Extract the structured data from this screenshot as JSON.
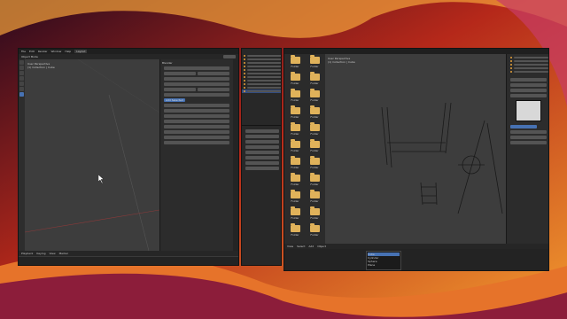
{
  "colors": {
    "accent": "#4772b3",
    "folder": "#e0b25a",
    "viewport": "#3d3d3d",
    "header": "#1f1f1f",
    "panel": "#2c2c2c"
  },
  "left_window": {
    "menus": [
      "File",
      "Edit",
      "Render",
      "Window",
      "Help"
    ],
    "active_tab": "Layout",
    "mode": "Object Mode",
    "viewport_info": [
      "User Perspective",
      "(1) Collection | Cube"
    ],
    "sidebar_title": "Blender",
    "sidebar_button": "Add Selected",
    "timeline_menus": [
      "Playback",
      "Keying",
      "View",
      "Marker"
    ]
  },
  "right_window": {
    "viewport_info": [
      "User Perspective",
      "(1) Collection | Cube"
    ],
    "bottom_menus": [
      "View",
      "Select",
      "Add",
      "Object"
    ],
    "popup_items": [
      "Cube",
      "Cylinder",
      "Sphere",
      "Plane"
    ]
  },
  "file_browser": {
    "folders": [
      "Folder",
      "Folder",
      "Folder",
      "Folder",
      "Folder",
      "Folder",
      "Folder",
      "Folder",
      "Folder",
      "Folder",
      "Folder",
      "Folder",
      "Folder",
      "Folder",
      "Folder",
      "Folder",
      "Folder",
      "Folder",
      "Folder",
      "Folder",
      "Folder",
      "Folder"
    ]
  }
}
